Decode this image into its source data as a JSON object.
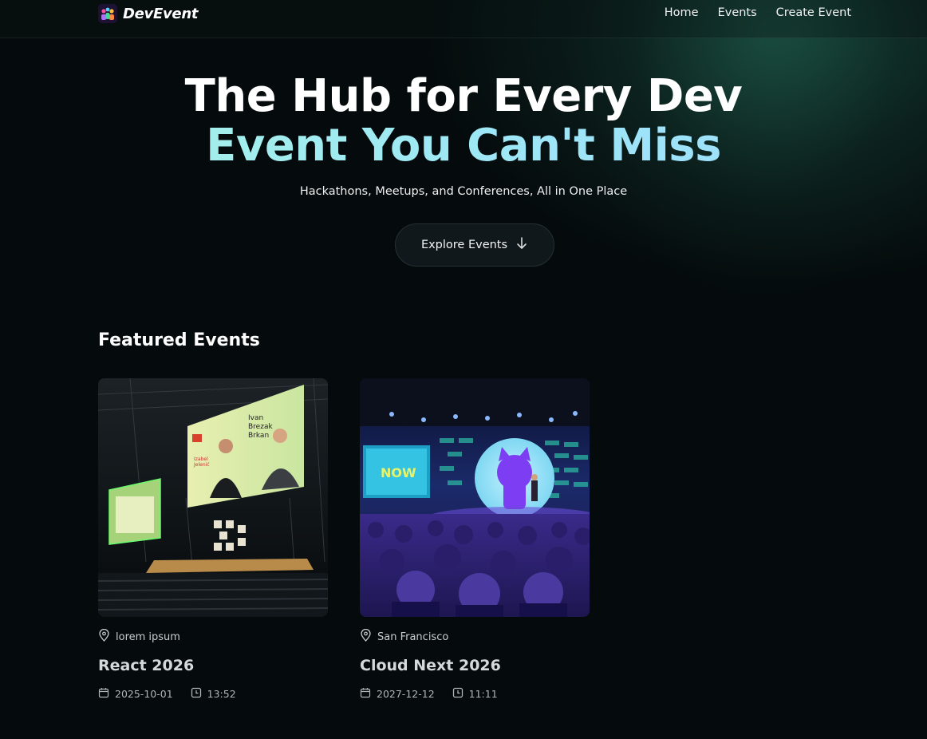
{
  "brand": {
    "name": "DevEvent",
    "logo_icon": "people-logo-icon"
  },
  "nav": {
    "items": [
      "Home",
      "Events",
      "Create Event"
    ]
  },
  "hero": {
    "title_line1": "The Hub for Every Dev",
    "title_line2": "Event You Can't Miss",
    "subtitle": "Hackathons, Meetups, and Conferences, All in One Place",
    "cta_label": "Explore Events",
    "cta_icon": "arrow-down-icon"
  },
  "featured": {
    "title": "Featured Events",
    "events": [
      {
        "location": "lorem ipsum",
        "title": "React 2026",
        "date": "2025-10-01",
        "time": "13:52",
        "image_screen_text": [
          "Ivan",
          "Brezak",
          "Brkan",
          "Izabel",
          "Jelenić"
        ]
      },
      {
        "location": "San Francisco",
        "title": "Cloud Next 2026",
        "date": "2027-12-12",
        "time": "11:11",
        "image_screen_text": [
          "NOW"
        ]
      }
    ]
  },
  "colors": {
    "background": "#040809",
    "accent_gradient_start": "#a7f3e4",
    "accent_gradient_end": "#9fdcff",
    "button_bg": "#10181b"
  }
}
